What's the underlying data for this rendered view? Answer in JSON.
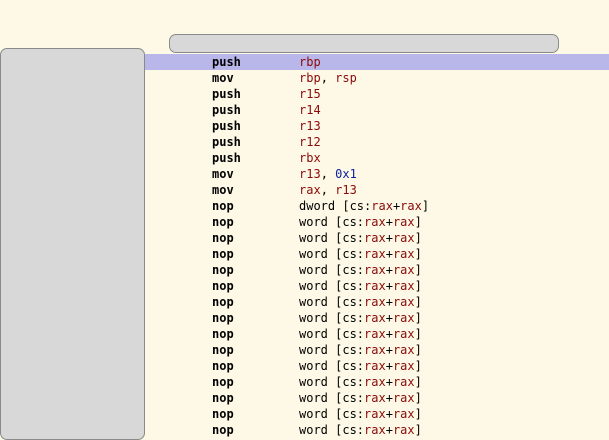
{
  "colors": {
    "background": "#fdf9e6",
    "selection": "#b9b6e9",
    "register": "#8b0a0a",
    "immediate": "#0b1f9e",
    "panel": "#d8d8d8"
  },
  "disassembly": {
    "selected_index": 0,
    "rows": [
      {
        "mnemonic": "push",
        "operands": [
          {
            "t": "reg",
            "v": "rbp"
          }
        ]
      },
      {
        "mnemonic": "mov",
        "operands": [
          {
            "t": "reg",
            "v": "rbp"
          },
          {
            "t": "plain",
            "v": ", "
          },
          {
            "t": "reg",
            "v": "rsp"
          }
        ]
      },
      {
        "mnemonic": "push",
        "operands": [
          {
            "t": "reg",
            "v": "r15"
          }
        ]
      },
      {
        "mnemonic": "push",
        "operands": [
          {
            "t": "reg",
            "v": "r14"
          }
        ]
      },
      {
        "mnemonic": "push",
        "operands": [
          {
            "t": "reg",
            "v": "r13"
          }
        ]
      },
      {
        "mnemonic": "push",
        "operands": [
          {
            "t": "reg",
            "v": "r12"
          }
        ]
      },
      {
        "mnemonic": "push",
        "operands": [
          {
            "t": "reg",
            "v": "rbx"
          }
        ]
      },
      {
        "mnemonic": "mov",
        "operands": [
          {
            "t": "reg",
            "v": "r13"
          },
          {
            "t": "plain",
            "v": ", "
          },
          {
            "t": "num",
            "v": "0x1"
          }
        ]
      },
      {
        "mnemonic": "mov",
        "operands": [
          {
            "t": "reg",
            "v": "rax"
          },
          {
            "t": "plain",
            "v": ", "
          },
          {
            "t": "reg",
            "v": "r13"
          }
        ]
      },
      {
        "mnemonic": "nop",
        "operands": [
          {
            "t": "plain",
            "v": "dword [cs:"
          },
          {
            "t": "reg",
            "v": "rax"
          },
          {
            "t": "plain",
            "v": "+"
          },
          {
            "t": "reg",
            "v": "rax"
          },
          {
            "t": "plain",
            "v": "]"
          }
        ]
      },
      {
        "mnemonic": "nop",
        "operands": [
          {
            "t": "plain",
            "v": "word [cs:"
          },
          {
            "t": "reg",
            "v": "rax"
          },
          {
            "t": "plain",
            "v": "+"
          },
          {
            "t": "reg",
            "v": "rax"
          },
          {
            "t": "plain",
            "v": "]"
          }
        ]
      },
      {
        "mnemonic": "nop",
        "operands": [
          {
            "t": "plain",
            "v": "word [cs:"
          },
          {
            "t": "reg",
            "v": "rax"
          },
          {
            "t": "plain",
            "v": "+"
          },
          {
            "t": "reg",
            "v": "rax"
          },
          {
            "t": "plain",
            "v": "]"
          }
        ]
      },
      {
        "mnemonic": "nop",
        "operands": [
          {
            "t": "plain",
            "v": "word [cs:"
          },
          {
            "t": "reg",
            "v": "rax"
          },
          {
            "t": "plain",
            "v": "+"
          },
          {
            "t": "reg",
            "v": "rax"
          },
          {
            "t": "plain",
            "v": "]"
          }
        ]
      },
      {
        "mnemonic": "nop",
        "operands": [
          {
            "t": "plain",
            "v": "word [cs:"
          },
          {
            "t": "reg",
            "v": "rax"
          },
          {
            "t": "plain",
            "v": "+"
          },
          {
            "t": "reg",
            "v": "rax"
          },
          {
            "t": "plain",
            "v": "]"
          }
        ]
      },
      {
        "mnemonic": "nop",
        "operands": [
          {
            "t": "plain",
            "v": "word [cs:"
          },
          {
            "t": "reg",
            "v": "rax"
          },
          {
            "t": "plain",
            "v": "+"
          },
          {
            "t": "reg",
            "v": "rax"
          },
          {
            "t": "plain",
            "v": "]"
          }
        ]
      },
      {
        "mnemonic": "nop",
        "operands": [
          {
            "t": "plain",
            "v": "word [cs:"
          },
          {
            "t": "reg",
            "v": "rax"
          },
          {
            "t": "plain",
            "v": "+"
          },
          {
            "t": "reg",
            "v": "rax"
          },
          {
            "t": "plain",
            "v": "]"
          }
        ]
      },
      {
        "mnemonic": "nop",
        "operands": [
          {
            "t": "plain",
            "v": "word [cs:"
          },
          {
            "t": "reg",
            "v": "rax"
          },
          {
            "t": "plain",
            "v": "+"
          },
          {
            "t": "reg",
            "v": "rax"
          },
          {
            "t": "plain",
            "v": "]"
          }
        ]
      },
      {
        "mnemonic": "nop",
        "operands": [
          {
            "t": "plain",
            "v": "word [cs:"
          },
          {
            "t": "reg",
            "v": "rax"
          },
          {
            "t": "plain",
            "v": "+"
          },
          {
            "t": "reg",
            "v": "rax"
          },
          {
            "t": "plain",
            "v": "]"
          }
        ]
      },
      {
        "mnemonic": "nop",
        "operands": [
          {
            "t": "plain",
            "v": "word [cs:"
          },
          {
            "t": "reg",
            "v": "rax"
          },
          {
            "t": "plain",
            "v": "+"
          },
          {
            "t": "reg",
            "v": "rax"
          },
          {
            "t": "plain",
            "v": "]"
          }
        ]
      },
      {
        "mnemonic": "nop",
        "operands": [
          {
            "t": "plain",
            "v": "word [cs:"
          },
          {
            "t": "reg",
            "v": "rax"
          },
          {
            "t": "plain",
            "v": "+"
          },
          {
            "t": "reg",
            "v": "rax"
          },
          {
            "t": "plain",
            "v": "]"
          }
        ]
      },
      {
        "mnemonic": "nop",
        "operands": [
          {
            "t": "plain",
            "v": "word [cs:"
          },
          {
            "t": "reg",
            "v": "rax"
          },
          {
            "t": "plain",
            "v": "+"
          },
          {
            "t": "reg",
            "v": "rax"
          },
          {
            "t": "plain",
            "v": "]"
          }
        ]
      },
      {
        "mnemonic": "nop",
        "operands": [
          {
            "t": "plain",
            "v": "word [cs:"
          },
          {
            "t": "reg",
            "v": "rax"
          },
          {
            "t": "plain",
            "v": "+"
          },
          {
            "t": "reg",
            "v": "rax"
          },
          {
            "t": "plain",
            "v": "]"
          }
        ]
      },
      {
        "mnemonic": "nop",
        "operands": [
          {
            "t": "plain",
            "v": "word [cs:"
          },
          {
            "t": "reg",
            "v": "rax"
          },
          {
            "t": "plain",
            "v": "+"
          },
          {
            "t": "reg",
            "v": "rax"
          },
          {
            "t": "plain",
            "v": "]"
          }
        ]
      },
      {
        "mnemonic": "nop",
        "operands": [
          {
            "t": "plain",
            "v": "word [cs:"
          },
          {
            "t": "reg",
            "v": "rax"
          },
          {
            "t": "plain",
            "v": "+"
          },
          {
            "t": "reg",
            "v": "rax"
          },
          {
            "t": "plain",
            "v": "]"
          }
        ]
      }
    ]
  }
}
